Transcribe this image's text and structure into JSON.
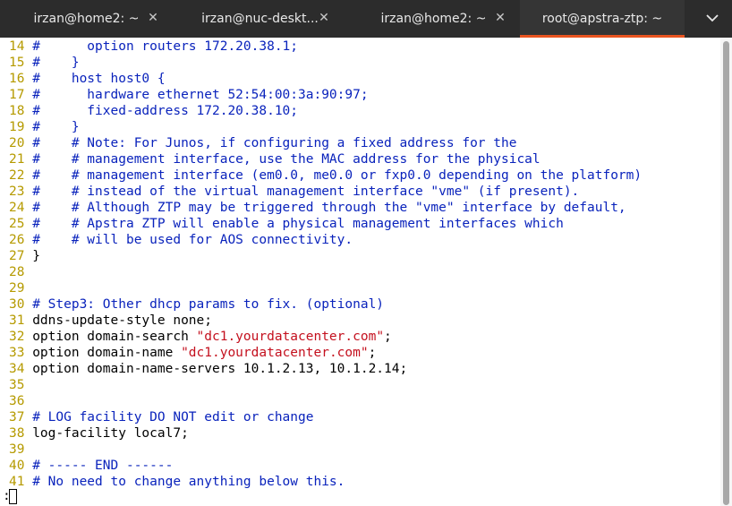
{
  "tabs": [
    {
      "title": "irzan@home2: ~",
      "active": false
    },
    {
      "title": "irzan@nuc-deskt...",
      "active": false
    },
    {
      "title": "irzan@home2: ~",
      "active": false
    },
    {
      "title": "root@apstra-ztp: ~",
      "active": true
    }
  ],
  "tab_close_glyph": "✕",
  "tab_menu_icon": "chevron-down-icon",
  "colors": {
    "line_number": "#b59a00",
    "comment": "#0a23bc",
    "string": "#c4101e",
    "active_tab_accent": "#e95420"
  },
  "lines": [
    {
      "num": "14",
      "segments": [
        {
          "t": "#      option routers 172.20.38.1;",
          "c": "cmt"
        }
      ]
    },
    {
      "num": "15",
      "segments": [
        {
          "t": "#    }",
          "c": "cmt"
        }
      ]
    },
    {
      "num": "16",
      "segments": [
        {
          "t": "#    host host0 {",
          "c": "cmt"
        }
      ]
    },
    {
      "num": "17",
      "segments": [
        {
          "t": "#      hardware ethernet 52:54:00:3a:90:97;",
          "c": "cmt"
        }
      ]
    },
    {
      "num": "18",
      "segments": [
        {
          "t": "#      fixed-address 172.20.38.10;",
          "c": "cmt"
        }
      ]
    },
    {
      "num": "19",
      "segments": [
        {
          "t": "#    }",
          "c": "cmt"
        }
      ]
    },
    {
      "num": "20",
      "segments": [
        {
          "t": "#    # Note: For Junos, if configuring a fixed address for the",
          "c": "cmt"
        }
      ]
    },
    {
      "num": "21",
      "segments": [
        {
          "t": "#    # management interface, use the MAC address for the physical",
          "c": "cmt"
        }
      ]
    },
    {
      "num": "22",
      "segments": [
        {
          "t": "#    # management interface (em0.0, me0.0 or fxp0.0 depending on the platform)",
          "c": "cmt"
        }
      ]
    },
    {
      "num": "23",
      "segments": [
        {
          "t": "#    # instead of the virtual management interface \"vme\" (if present).",
          "c": "cmt"
        }
      ]
    },
    {
      "num": "24",
      "segments": [
        {
          "t": "#    # Although ZTP may be triggered through the \"vme\" interface by default,",
          "c": "cmt"
        }
      ]
    },
    {
      "num": "25",
      "segments": [
        {
          "t": "#    # Apstra ZTP will enable a physical management interfaces which",
          "c": "cmt"
        }
      ]
    },
    {
      "num": "26",
      "segments": [
        {
          "t": "#    # will be used for AOS connectivity.",
          "c": "cmt"
        }
      ]
    },
    {
      "num": "27",
      "segments": [
        {
          "t": "}",
          "c": "norm"
        }
      ]
    },
    {
      "num": "28",
      "segments": []
    },
    {
      "num": "29",
      "segments": []
    },
    {
      "num": "30",
      "segments": [
        {
          "t": "# Step3: Other dhcp params to fix. (optional)",
          "c": "cmt"
        }
      ]
    },
    {
      "num": "31",
      "segments": [
        {
          "t": "ddns-update-style none;",
          "c": "norm"
        }
      ]
    },
    {
      "num": "32",
      "segments": [
        {
          "t": "option domain-search ",
          "c": "norm"
        },
        {
          "t": "\"dc1.yourdatacenter.com\"",
          "c": "str"
        },
        {
          "t": ";",
          "c": "norm"
        }
      ]
    },
    {
      "num": "33",
      "segments": [
        {
          "t": "option domain-name ",
          "c": "norm"
        },
        {
          "t": "\"dc1.yourdatacenter.com\"",
          "c": "str"
        },
        {
          "t": ";",
          "c": "norm"
        }
      ]
    },
    {
      "num": "34",
      "segments": [
        {
          "t": "option domain-name-servers 10.1.2.13, 10.1.2.14;",
          "c": "norm"
        }
      ]
    },
    {
      "num": "35",
      "segments": []
    },
    {
      "num": "36",
      "segments": []
    },
    {
      "num": "37",
      "segments": [
        {
          "t": "# LOG facility DO NOT edit or change",
          "c": "cmt"
        }
      ]
    },
    {
      "num": "38",
      "segments": [
        {
          "t": "log-facility local7;",
          "c": "norm"
        }
      ]
    },
    {
      "num": "39",
      "segments": []
    },
    {
      "num": "40",
      "segments": [
        {
          "t": "# ----- END ------",
          "c": "cmt"
        }
      ]
    },
    {
      "num": "41",
      "segments": [
        {
          "t": "# No need to change anything below this.",
          "c": "cmt"
        }
      ]
    }
  ],
  "command_line": ":"
}
